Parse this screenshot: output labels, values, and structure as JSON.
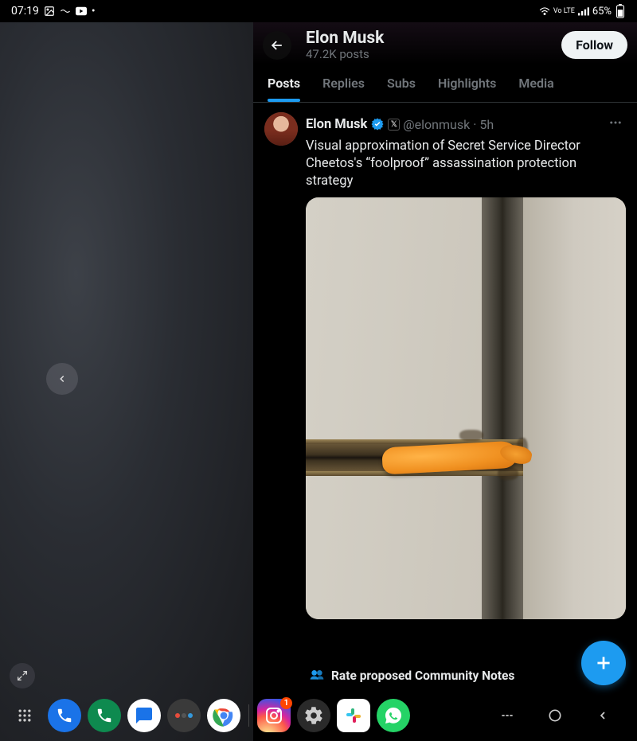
{
  "status": {
    "time": "07:19",
    "network_label": "Vo LTE",
    "battery": "65%"
  },
  "profile": {
    "name": "Elon Musk",
    "post_count": "47.2K posts",
    "follow_label": "Follow"
  },
  "tabs": [
    {
      "label": "Posts",
      "active": true
    },
    {
      "label": "Replies",
      "active": false
    },
    {
      "label": "Subs",
      "active": false
    },
    {
      "label": "Highlights",
      "active": false
    },
    {
      "label": "Media",
      "active": false
    }
  ],
  "tweet": {
    "author": "Elon Musk",
    "handle": "@elonmusk",
    "time_sep": "·",
    "time": "5h",
    "text": "Visual approximation of Secret Service Director Cheetos's “foolproof” assassination protection strategy"
  },
  "community_notes": {
    "label": "Rate proposed Community Notes"
  },
  "dock": {
    "instagram_badge": "1"
  }
}
